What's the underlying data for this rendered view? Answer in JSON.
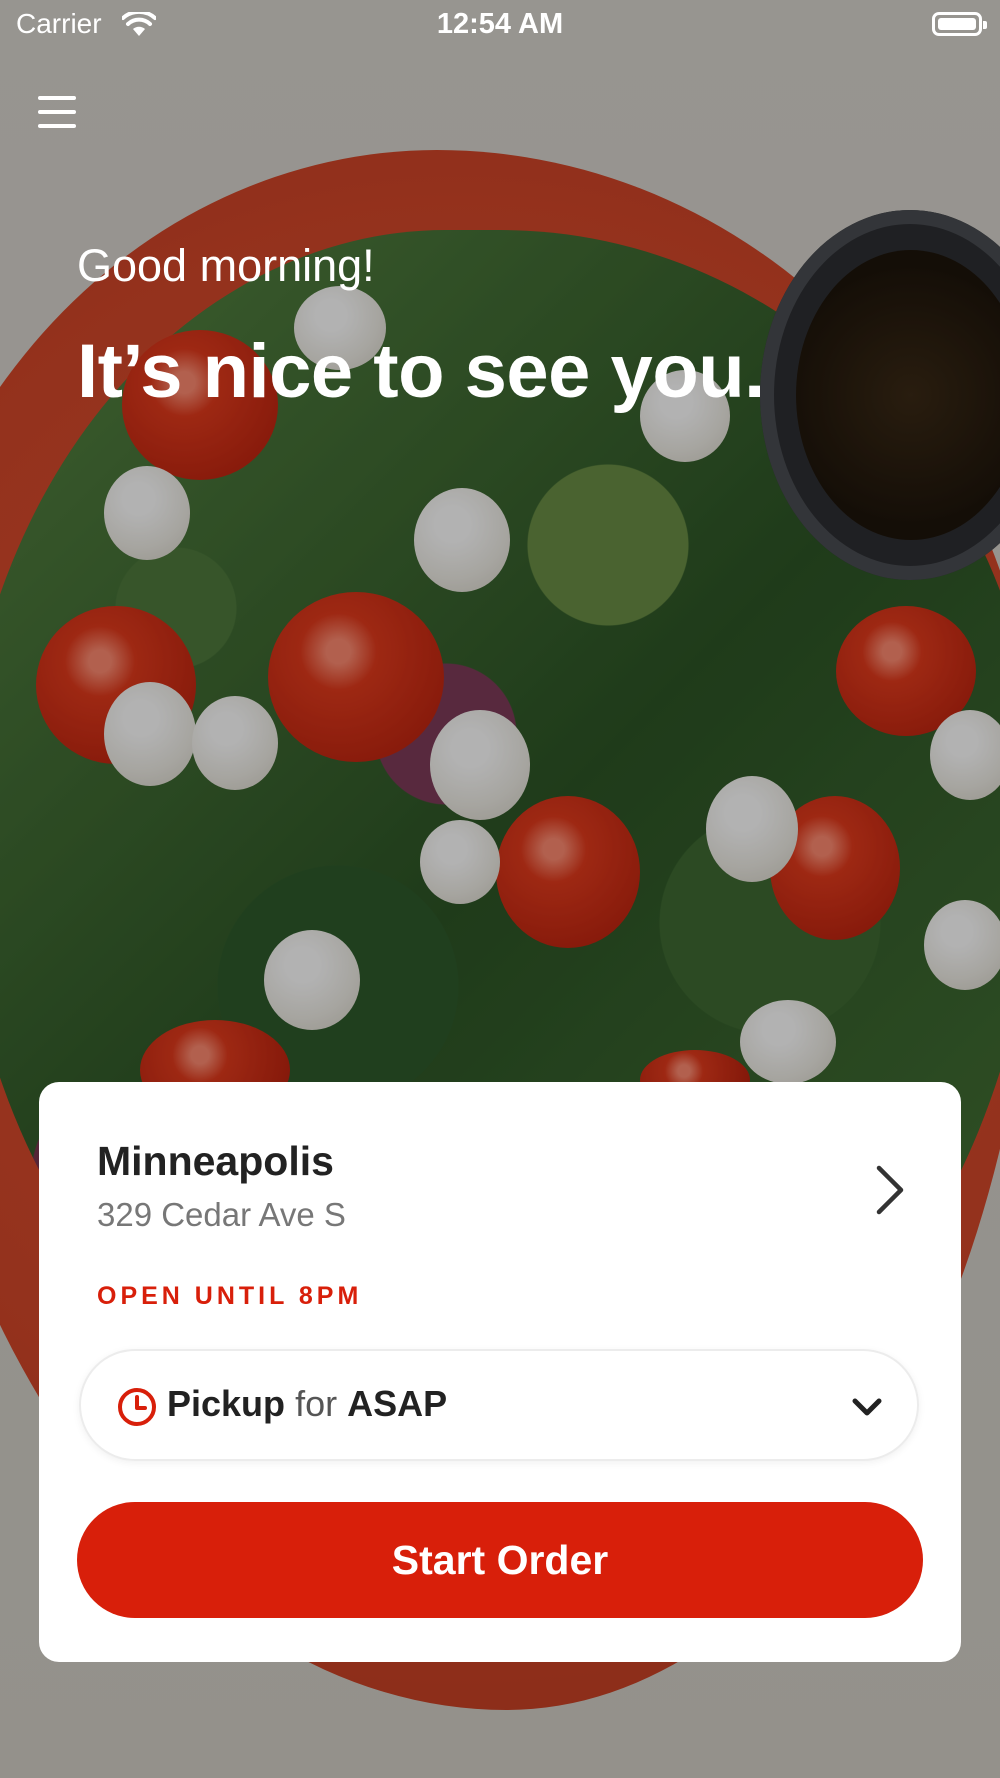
{
  "status_bar": {
    "carrier": "Carrier",
    "time": "12:54 AM",
    "wifi_icon": "wifi-icon",
    "battery_icon": "battery-icon"
  },
  "menu": {
    "icon": "hamburger-menu-icon"
  },
  "greeting": {
    "line1": "Good morning!",
    "line2": "It’s nice to see you."
  },
  "location": {
    "name": "Minneapolis",
    "address": "329 Cedar Ave S",
    "hours": "OPEN UNTIL 8PM",
    "chevron_icon": "chevron-right-icon"
  },
  "order_mode": {
    "clock_icon": "clock-icon",
    "mode": "Pickup",
    "connector": "for",
    "time": "ASAP",
    "dropdown_icon": "chevron-down-icon"
  },
  "start_order": {
    "label": "Start Order"
  },
  "colors": {
    "accent": "#d81f0a",
    "text_dark": "#222222",
    "text_muted": "#777777",
    "card_bg": "#ffffff"
  }
}
